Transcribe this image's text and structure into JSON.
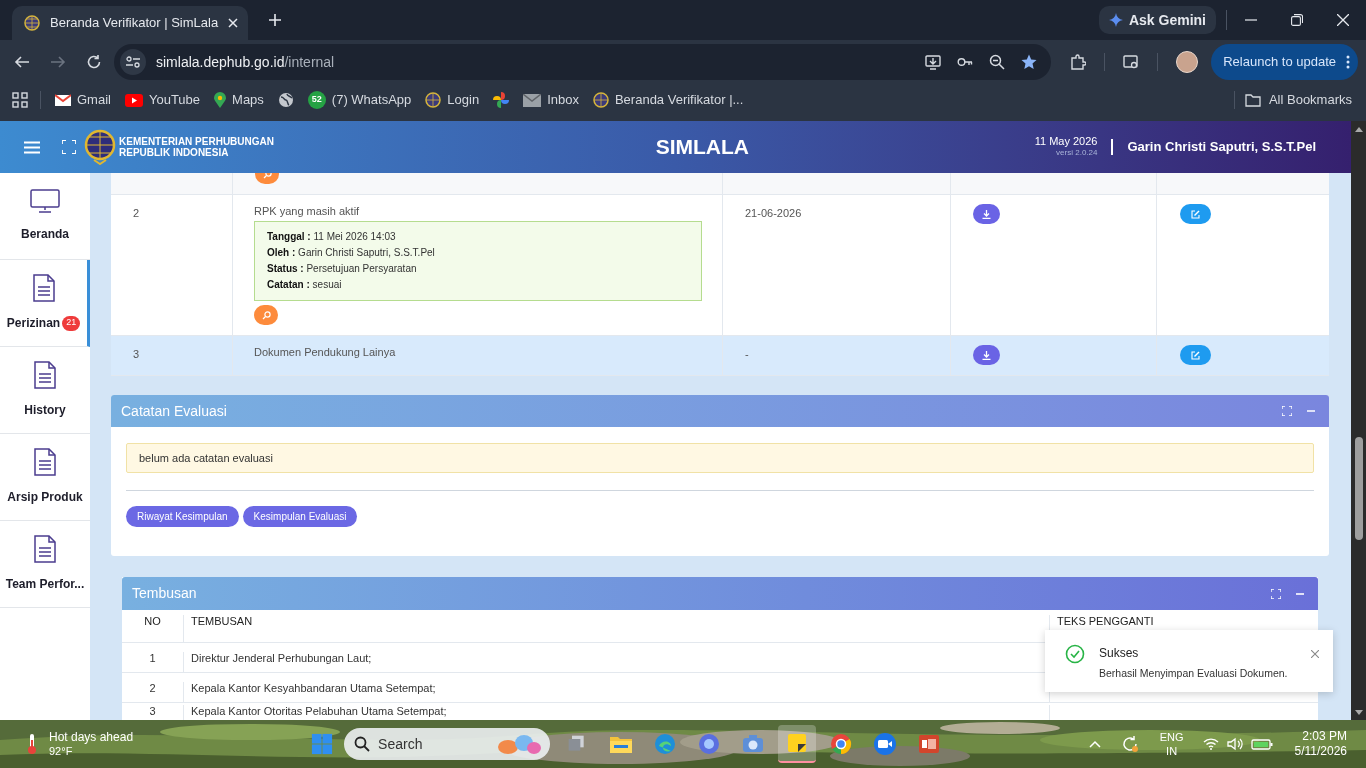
{
  "browser": {
    "tab_title": "Beranda Verifikator | SimLala",
    "ask_gemini": "Ask Gemini",
    "url_host": "simlala.dephub.go.id",
    "url_path": "/internal",
    "relaunch": "Relaunch to update",
    "bookmarks": [
      {
        "label": "Gmail"
      },
      {
        "label": "YouTube"
      },
      {
        "label": "Maps"
      },
      {
        "label": "(7) WhatsApp",
        "badge": "52"
      },
      {
        "label": "Login"
      },
      {
        "label": "Inbox"
      },
      {
        "label": "Beranda Verifikator |..."
      }
    ],
    "all_bookmarks": "All Bookmarks"
  },
  "header": {
    "org_line1": "KEMENTERIAN PERHUBUNGAN",
    "org_line2": "REPUBLIK INDONESIA",
    "app_title": "SIMLALA",
    "date": "11 May 2026",
    "version": "versi 2.0.24",
    "user": "Garin Christi Saputri, S.S.T.Pel"
  },
  "sidebar": {
    "items": [
      {
        "label": "Beranda",
        "selected": false
      },
      {
        "label": "Perizinan",
        "selected": true,
        "badge": "21"
      },
      {
        "label": "History",
        "selected": false
      },
      {
        "label": "Arsip Produk",
        "selected": false
      },
      {
        "label": "Team Perfor...",
        "selected": false
      }
    ]
  },
  "documents": {
    "rows": [
      {
        "kind": "cut",
        "highlighted": false
      },
      {
        "kind": "full",
        "highlighted": false,
        "no": "2",
        "name": "RPK yang masih aktif",
        "history": [
          {
            "label": "Tanggal :",
            "value": "11 Mei 2026 14:03"
          },
          {
            "label": "Oleh :",
            "value": "Garin Christi Saputri, S.S.T.Pel"
          },
          {
            "label": "Status :",
            "value": "Persetujuan Persyaratan"
          },
          {
            "label": "Catatan :",
            "value": "sesuai"
          }
        ],
        "date": "21-06-2026"
      },
      {
        "kind": "full",
        "highlighted": true,
        "no": "3",
        "name": "Dokumen Pendukung Lainya",
        "date": "-"
      }
    ]
  },
  "catatan_evaluasi": {
    "title": "Catatan Evaluasi",
    "notice": "belum ada catatan evaluasi",
    "buttons": [
      "Riwayat Kesimpulan",
      "Kesimpulan Evaluasi"
    ]
  },
  "tembusan": {
    "title": "Tembusan",
    "columns": [
      "NO",
      "TEMBUSAN",
      "TEKS PENGGANTI"
    ],
    "rows": [
      {
        "no": "1",
        "text": "Direktur Jenderal Perhubungan Laut;"
      },
      {
        "no": "2",
        "text": "Kepala Kantor Kesyahbandaran Utama Setempat;"
      },
      {
        "no": "3",
        "text": "Kepala Kantor Otoritas Pelabuhan Utama Setempat;"
      }
    ]
  },
  "toast": {
    "title": "Sukses",
    "message": "Berhasil Menyimpan Evaluasi Dokumen."
  },
  "taskbar": {
    "weather_title": "Hot days ahead",
    "weather_temp": "92°F",
    "search": "Search",
    "lang1": "ENG",
    "lang2": "IN",
    "time": "2:03 PM",
    "date": "5/11/2026"
  }
}
